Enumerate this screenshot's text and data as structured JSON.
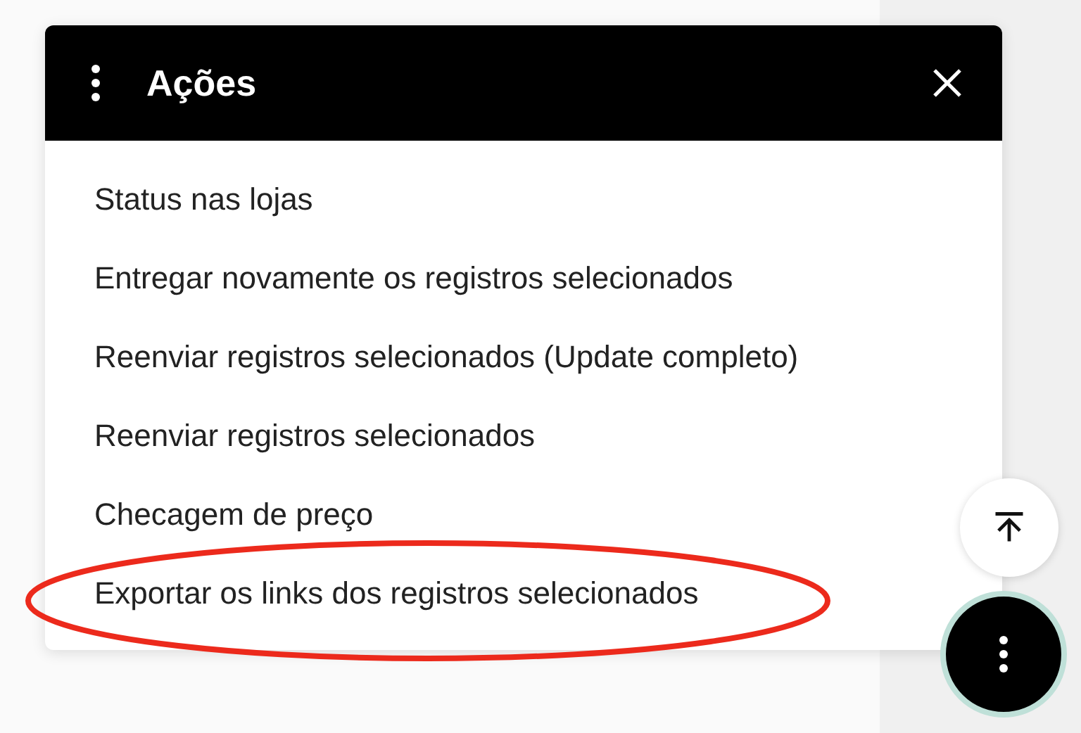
{
  "menu": {
    "title": "Ações",
    "items": [
      {
        "label": "Status nas lojas",
        "highlighted": false
      },
      {
        "label": "Entregar novamente os registros selecionados",
        "highlighted": false
      },
      {
        "label": "Reenviar registros selecionados (Update completo)",
        "highlighted": false
      },
      {
        "label": "Reenviar registros selecionados",
        "highlighted": false
      },
      {
        "label": "Checagem de preço",
        "highlighted": false
      },
      {
        "label": "Exportar os links dos registros selecionados",
        "highlighted": true
      }
    ]
  }
}
